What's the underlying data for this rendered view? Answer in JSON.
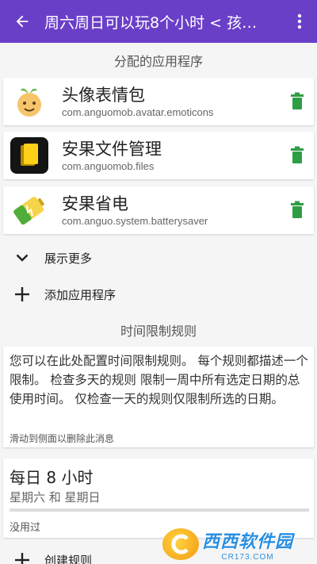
{
  "appbar": {
    "title": "周六周日可以玩8个小时 < 孩…",
    "back_icon": "arrow-left-icon",
    "menu_icon": "more-vert-icon"
  },
  "colors": {
    "primary": "#6a3fc8",
    "trash": "#2e9e44"
  },
  "apps_section": {
    "header": "分配的应用程序",
    "apps": [
      {
        "name": "头像表情包",
        "package": "com.anguomob.avatar.emoticons",
        "icon": "emoticon-face-icon"
      },
      {
        "name": "安果文件管理",
        "package": "com.anguomob.files",
        "icon": "file-manager-icon"
      },
      {
        "name": "安果省电",
        "package": "com.anguo.system.batterysaver",
        "icon": "battery-icon"
      }
    ],
    "show_more": "展示更多",
    "add_app": "添加应用程序"
  },
  "rules_section": {
    "header": "时间限制规则",
    "info_text": "您可以在此处配置时间限制规则。 每个规则都描述一个限制。 检查多天的规则 限制一周中所有选定日期的总使用时间。 仅检查一天的规则仅限制所选的日期。",
    "swipe_hint": "滑动到侧面以删除此消息",
    "rules": [
      {
        "title": "每日 8 小时",
        "days": "星期六 和 星期日",
        "usage": "没用过",
        "progress": 0
      }
    ],
    "create_rule": "创建规则"
  },
  "watermark": {
    "main": "西西软件园",
    "sub": "CR173.COM"
  }
}
